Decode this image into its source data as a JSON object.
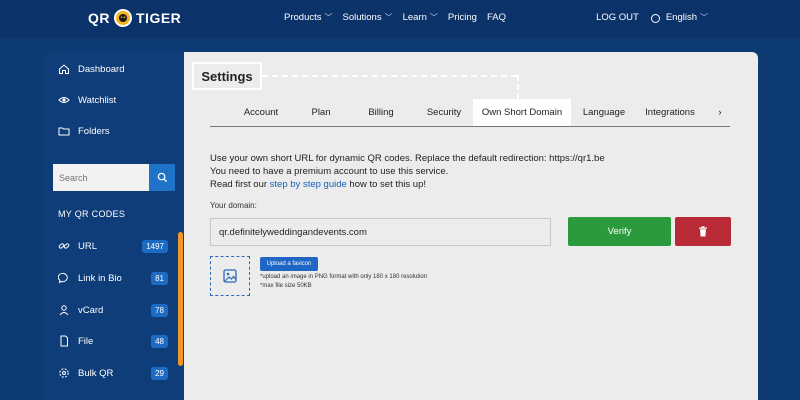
{
  "brand": {
    "logo_left": "QR",
    "logo_right": "TIGER"
  },
  "nav": {
    "items": [
      {
        "label": "Products",
        "dropdown": true
      },
      {
        "label": "Solutions",
        "dropdown": true
      },
      {
        "label": "Learn",
        "dropdown": true
      },
      {
        "label": "Pricing",
        "dropdown": false
      },
      {
        "label": "FAQ",
        "dropdown": false
      }
    ],
    "logout": "LOG OUT",
    "language": "English"
  },
  "sidebar": {
    "links": [
      {
        "label": "Dashboard",
        "icon": "home-icon"
      },
      {
        "label": "Watchlist",
        "icon": "eye-icon"
      },
      {
        "label": "Folders",
        "icon": "folder-icon"
      }
    ],
    "search_placeholder": "Search",
    "section_title": "MY QR CODES",
    "qr_items": [
      {
        "label": "URL",
        "count": "1497",
        "icon": "link-icon"
      },
      {
        "label": "Link in Bio",
        "count": "81",
        "icon": "chat-icon"
      },
      {
        "label": "vCard",
        "count": "78",
        "icon": "user-icon"
      },
      {
        "label": "File",
        "count": "48",
        "icon": "file-icon"
      },
      {
        "label": "Bulk QR",
        "count": "29",
        "icon": "bulk-icon"
      }
    ]
  },
  "main": {
    "title": "Settings",
    "tabs": [
      {
        "label": "Account",
        "active": false
      },
      {
        "label": "Plan",
        "active": false
      },
      {
        "label": "Billing",
        "active": false
      },
      {
        "label": "Security",
        "active": false
      },
      {
        "label": "Own Short Domain",
        "active": true
      },
      {
        "label": "Language",
        "active": false
      },
      {
        "label": "Integrations",
        "active": false
      },
      {
        "label": "›",
        "active": false
      }
    ],
    "info": {
      "line1": "Use your own short URL for dynamic QR codes. Replace the default redirection: https://qr1.be",
      "line2": "You need to have a premium account to use this service.",
      "line3_pre": "Read first our ",
      "line3_link": "step by step guide",
      "line3_post": " how to set this up!"
    },
    "domain_label": "Your domain:",
    "domain_value": "qr.definitelyweddingandevents.com",
    "verify_label": "Verify",
    "upload_label": "Upload a favicon",
    "hint1": "*upload an image in PNG format with only 180 x 180 resolution",
    "hint2": "*max file size 50KB"
  },
  "colors": {
    "navy": "#0d3a73",
    "accent_blue": "#1e72c8",
    "verify_green": "#2a9a3c",
    "delete_red": "#b82a35",
    "scroll_orange": "#f0962a"
  }
}
